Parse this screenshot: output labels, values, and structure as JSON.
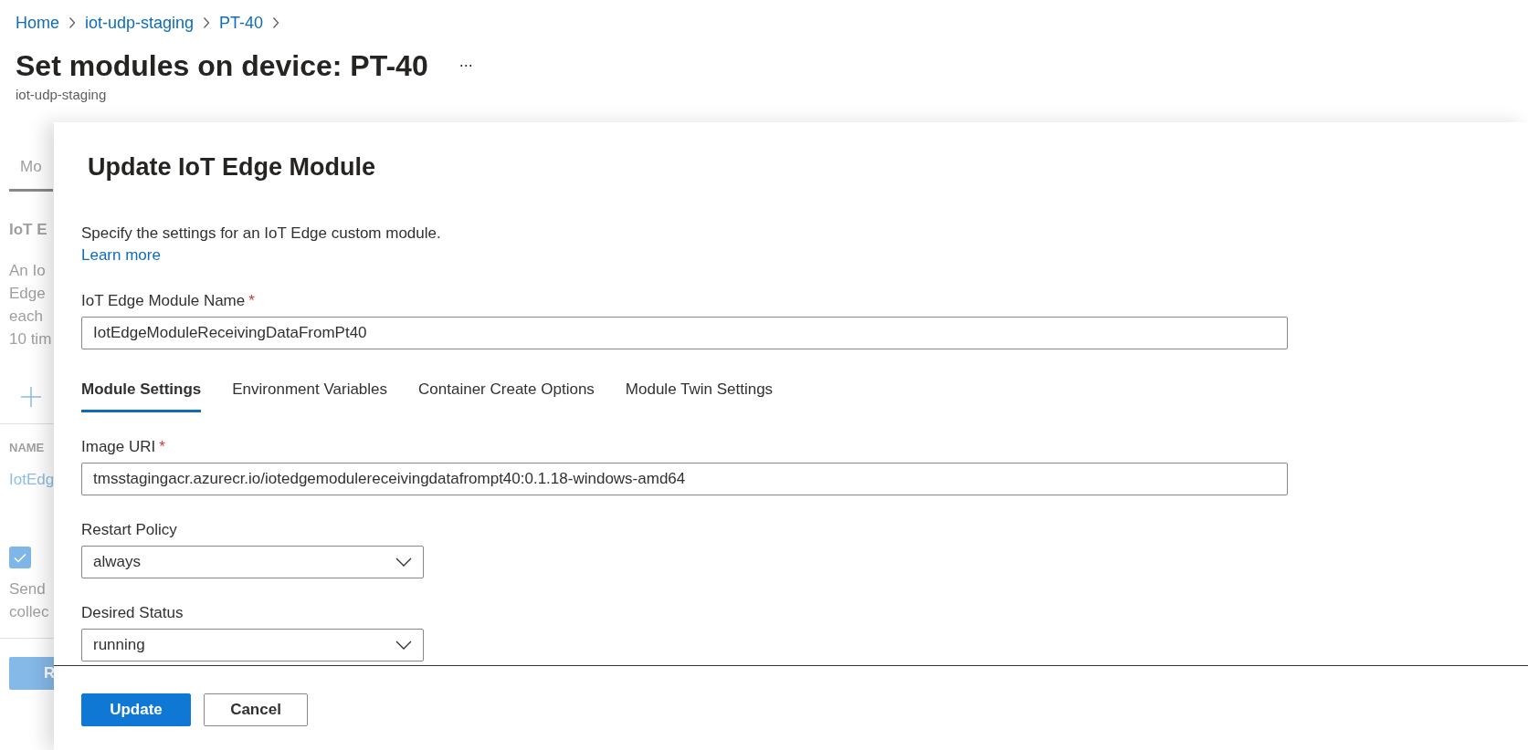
{
  "breadcrumb": [
    {
      "label": "Home"
    },
    {
      "label": "iot-udp-staging"
    },
    {
      "label": "PT-40"
    }
  ],
  "page": {
    "title": "Set modules on device: PT-40",
    "more": "...",
    "subtitle": "iot-udp-staging"
  },
  "background_panel": {
    "tab": "Mo",
    "heading": "IoT E",
    "description": [
      "An Io",
      "Edge",
      "each",
      "10 tim"
    ],
    "column_header": "NAME",
    "row": "IotEdg",
    "checkbox": {
      "checked": true
    },
    "checkbox_text": [
      "Send",
      "collec"
    ],
    "button": "R"
  },
  "flyout": {
    "title": "Update IoT Edge Module",
    "description": "Specify the settings for an IoT Edge custom module.",
    "link": "Learn more",
    "name_field": {
      "label": "IoT Edge Module Name",
      "required_mark": "*",
      "value": "IotEdgeModuleReceivingDataFromPt40"
    },
    "tabs": [
      {
        "label": "Module Settings",
        "selected": true
      },
      {
        "label": "Environment Variables",
        "selected": false
      },
      {
        "label": "Container Create Options",
        "selected": false
      },
      {
        "label": "Module Twin Settings",
        "selected": false
      }
    ],
    "fields": [
      {
        "kind": "text",
        "label": "Image URI",
        "required_mark": "*",
        "value": "tmsstagingacr.azurecr.io/iotedgemodulereceivingdatafrompt40:0.1.18-windows-amd64"
      },
      {
        "kind": "select",
        "label": "Restart Policy",
        "value": "always"
      },
      {
        "kind": "select",
        "label": "Desired Status",
        "value": "running"
      }
    ],
    "buttons": [
      {
        "label": "Update",
        "kind": "primary"
      },
      {
        "label": "Cancel",
        "kind": "secondary"
      }
    ]
  }
}
